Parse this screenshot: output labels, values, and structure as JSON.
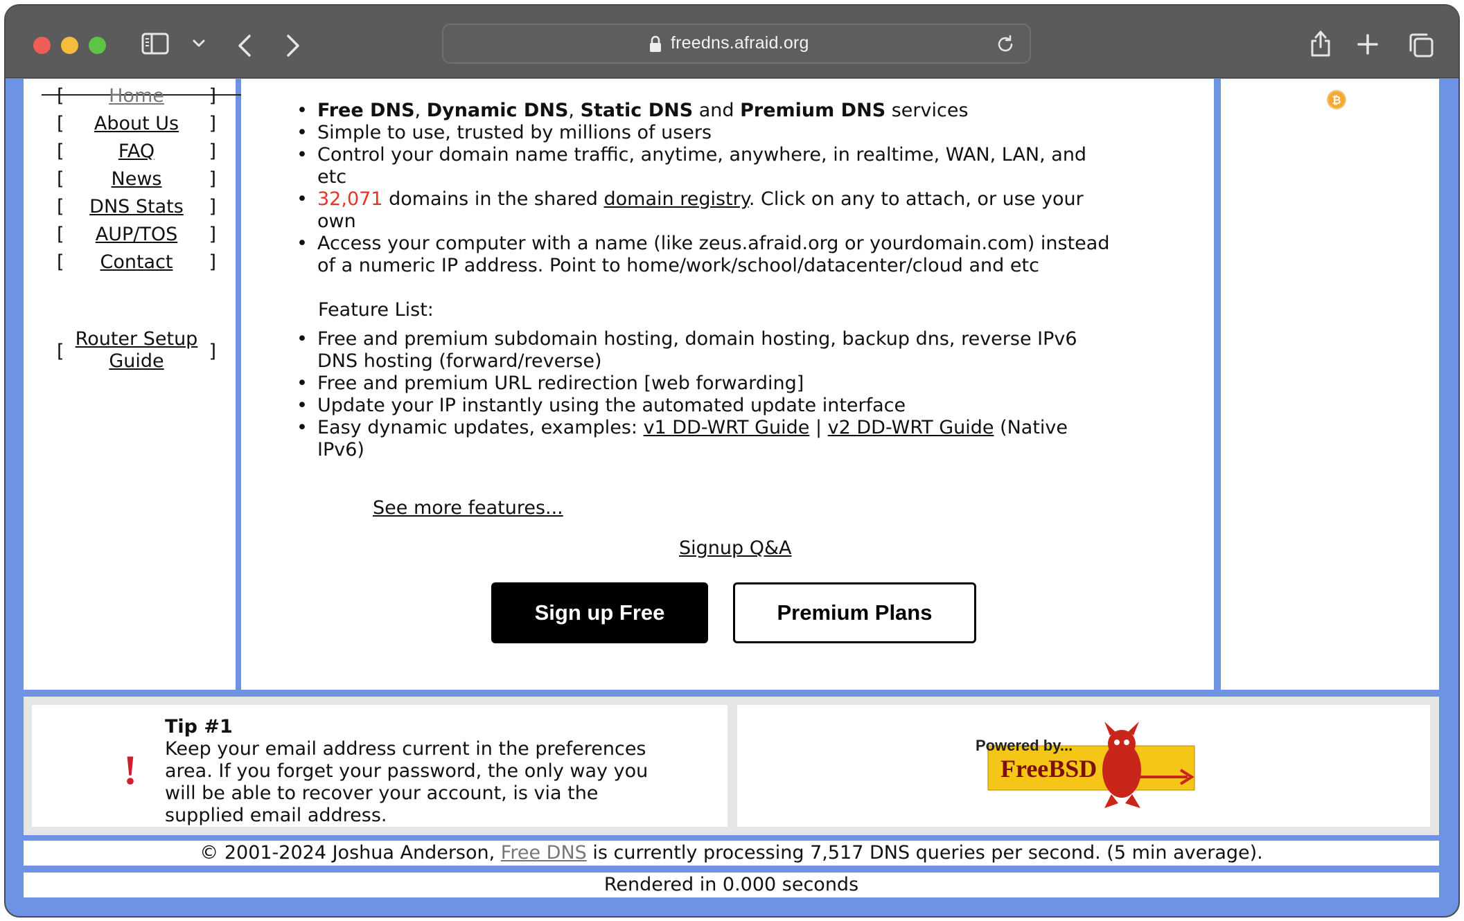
{
  "browser": {
    "url": "freedns.afraid.org"
  },
  "nav": {
    "items": [
      {
        "label": "Home",
        "current": true
      },
      {
        "label": "About Us"
      },
      {
        "label": "FAQ"
      },
      {
        "label": "News"
      },
      {
        "label": "DNS Stats"
      },
      {
        "label": "AUP/TOS"
      },
      {
        "label": "Contact"
      }
    ],
    "router_line1": "Router Setup",
    "router_line2": "Guide",
    "bracket_open": "[",
    "bracket_close": "]"
  },
  "main": {
    "bullets": {
      "b1_free": "Free DNS",
      "b1_sep1": ", ",
      "b1_dynamic": "Dynamic DNS",
      "b1_sep2": ", ",
      "b1_static": "Static DNS",
      "b1_and": " and ",
      "b1_premium": "Premium DNS",
      "b1_tail": " services",
      "b2": "Simple to use, trusted by millions of users",
      "b3": "Control your domain name traffic, anytime, anywhere, in realtime, WAN, LAN, and etc",
      "b4_count": "32,071",
      "b4_mid": " domains in the shared ",
      "b4_link": "domain registry",
      "b4_tail": ". Click on any to attach, or use your own",
      "b5": "Access your computer with a name (like zeus.afraid.org or yourdomain.com) instead of a numeric IP address. Point to home/work/school/datacenter/cloud and etc"
    },
    "feature_heading": "Feature List:",
    "features": {
      "f1": "Free and premium subdomain hosting, domain hosting, backup dns, reverse IPv6 DNS hosting (forward/reverse)",
      "f2": "Free and premium URL redirection [web forwarding]",
      "f3": "Update your IP instantly using the automated update interface",
      "f4_pre": "Easy dynamic updates, examples: ",
      "f4_link1": "v1 DD-WRT Guide",
      "f4_sep": " | ",
      "f4_link2": "v2 DD-WRT Guide",
      "f4_tail": " (Native IPv6)"
    },
    "see_more": "See more features...",
    "signup_qa": "Signup Q&A",
    "signup_button": "Sign up Free",
    "premium_button": "Premium Plans"
  },
  "tip": {
    "mark": "!",
    "title": "Tip #1",
    "text": "Keep your email address current in the preferences area. If you forget your password, the only way you will be able to recover your account, is via the supplied email address."
  },
  "powered": {
    "line1": "Powered by...",
    "line2": "FreeBSD"
  },
  "footer": {
    "copy_pre": "© 2001-2024 Joshua Anderson, ",
    "copy_link": "Free DNS",
    "copy_tail": " is currently processing 7,517 DNS queries per second. (5 min average).",
    "rendered": "Rendered in 0.000 seconds"
  },
  "colors": {
    "page_bg": "#6f93e4",
    "toolbar": "#5b5b5b",
    "accent_red": "#e53324"
  }
}
